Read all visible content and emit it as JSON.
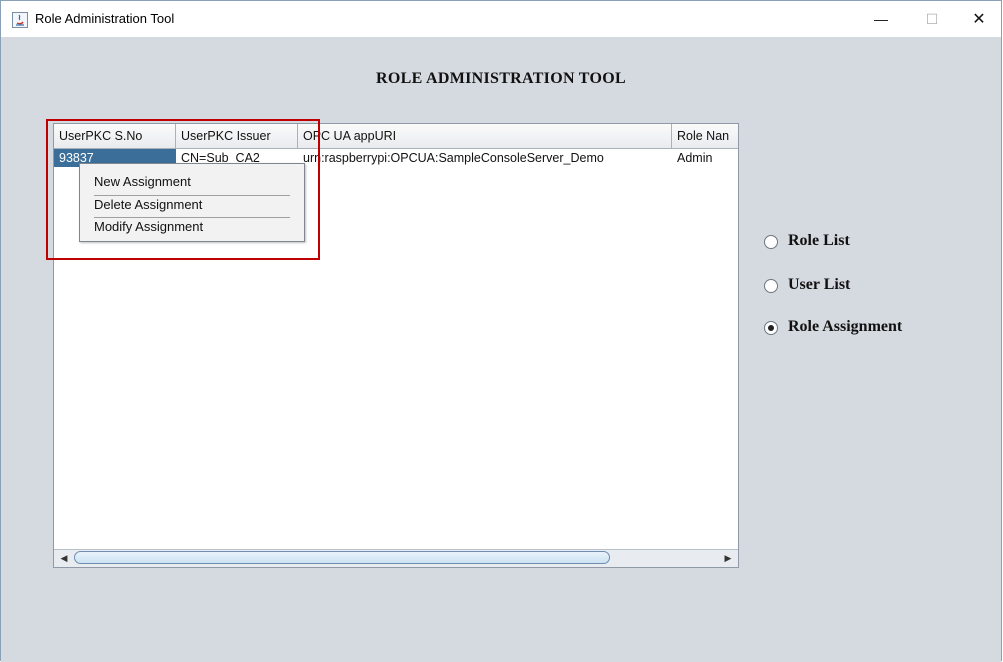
{
  "window": {
    "title": "Role Administration Tool",
    "minimize_glyph": "—",
    "maximize_glyph": "☐",
    "close_glyph": "✕"
  },
  "heading": "ROLE ADMINISTRATION TOOL",
  "table": {
    "columns": [
      "UserPKC S.No",
      "UserPKC Issuer",
      "OPC UA appURI",
      "Role Nan"
    ],
    "rows": [
      [
        "93837",
        "CN=Sub_CA2",
        "urn:raspberrypi:OPCUA:SampleConsoleServer_Demo",
        "Admin"
      ]
    ],
    "selected_row": 0
  },
  "context_menu": {
    "items": [
      "New Assignment",
      "Delete Assignment",
      "Modify Assignment"
    ]
  },
  "radio_options": [
    {
      "label": "Role List",
      "checked": false
    },
    {
      "label": "User List",
      "checked": false
    },
    {
      "label": "Role Assignment",
      "checked": true
    }
  ],
  "colors": {
    "selection": "#3b6f9a",
    "annotation_box": "#c00000",
    "panel_bg": "#d5d9e0"
  }
}
